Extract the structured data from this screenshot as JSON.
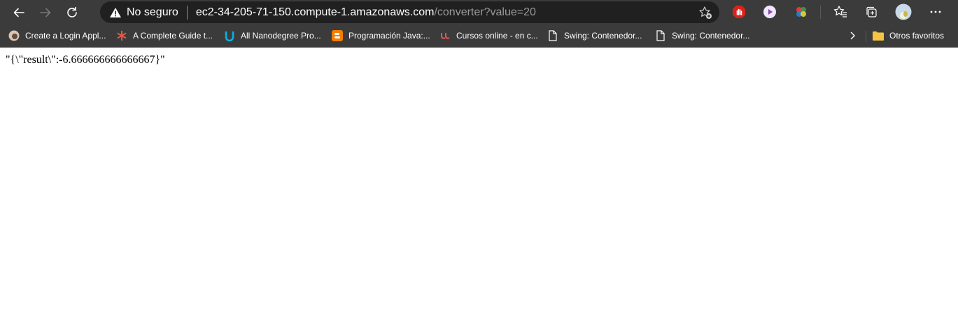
{
  "address_bar": {
    "security_label": "No seguro",
    "url_host": "ec2-34-205-71-150.compute-1.amazonaws.com",
    "url_path": "/converter?value=20"
  },
  "toolbar_icons": {
    "back": "back-arrow-icon",
    "forward": "forward-arrow-icon",
    "refresh": "refresh-icon",
    "warning": "warning-icon",
    "add_favorite": "add-favorite-icon",
    "collections": "collections-icon",
    "favorites": "favorites-icon",
    "profile": "profile-avatar",
    "menu": "more-menu-icon"
  },
  "bookmarks": [
    {
      "label": "Create a Login Appl...",
      "icon": "site-favicon"
    },
    {
      "label": "A Complete Guide t...",
      "icon": "asterisk-favicon"
    },
    {
      "label": "All Nanodegree Pro...",
      "icon": "udacity-favicon"
    },
    {
      "label": "Programación Java:...",
      "icon": "blogger-favicon"
    },
    {
      "label": "Cursos online - en c...",
      "icon": "udemy-favicon"
    },
    {
      "label": "Swing: Contenedor...",
      "icon": "page-icon"
    },
    {
      "label": "Swing: Contenedor...",
      "icon": "page-icon"
    }
  ],
  "other_favorites": "Otros favoritos",
  "page": {
    "content": "\"{\\\"result\\\":-6.666666666666667}\""
  },
  "colors": {
    "chrome": "#3b3b3b",
    "address_bg": "#202020",
    "text_light": "#ffffff",
    "url_path": "#9a9a9a",
    "page_bg": "#ffffff"
  }
}
